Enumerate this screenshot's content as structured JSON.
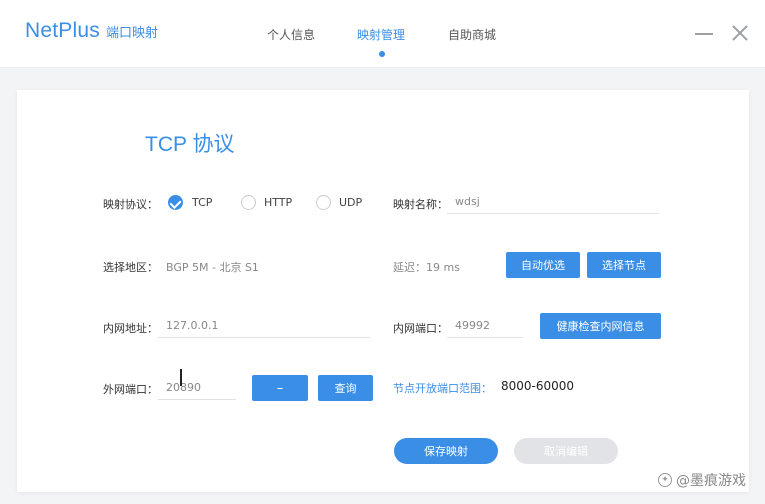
{
  "app": {
    "name": "NetPlus",
    "subtitle": "端口映射"
  },
  "nav": {
    "items": [
      {
        "label": "个人信息",
        "active": false
      },
      {
        "label": "映射管理",
        "active": true
      },
      {
        "label": "自助商城",
        "active": false
      }
    ]
  },
  "page": {
    "title": "TCP 协议"
  },
  "form": {
    "protocol": {
      "label": "映射协议：",
      "options": [
        "TCP",
        "HTTP",
        "UDP"
      ],
      "selected": "TCP"
    },
    "mapping_name": {
      "label": "映射名称：",
      "value": "wdsj"
    },
    "region": {
      "label": "选择地区：",
      "value": "BGP 5M - 北京 S1"
    },
    "latency": {
      "text": "延迟：19 ms"
    },
    "auto_select_label": "自动优选",
    "choose_node_label": "选择节点",
    "local_address": {
      "label": "内网地址：",
      "value": "127.0.0.1"
    },
    "local_port": {
      "label": "内网端口：",
      "value": "49992"
    },
    "health_check_label": "健康检查内网信息",
    "external_port": {
      "label": "外网端口：",
      "value": "20890"
    },
    "dash_label": "–",
    "query_label": "查询",
    "port_range": {
      "label": "节点开放端口范围：",
      "value": "8000-60000"
    },
    "save_label": "保存映射",
    "cancel_label": "取消编辑"
  },
  "watermark": {
    "text": "@墨痕游戏"
  },
  "colors": {
    "accent": "#3a8ee6",
    "disabled": "#e1e3e6"
  }
}
